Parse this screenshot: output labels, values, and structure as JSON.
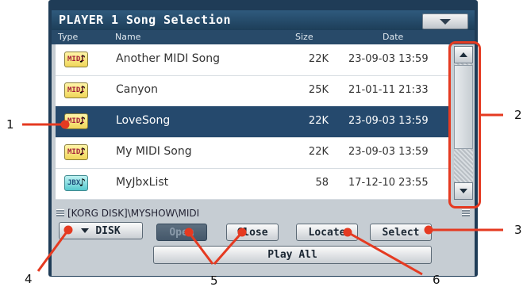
{
  "window": {
    "title": "PLAYER 1 Song Selection"
  },
  "columns": {
    "type": "Type",
    "name": "Name",
    "size": "Size",
    "date": "Date"
  },
  "rows": [
    {
      "icon": "MIDI",
      "name": "Another MIDI Song",
      "size": "22K",
      "date": "23-09-03 13:59",
      "selected": false
    },
    {
      "icon": "MIDI",
      "name": "Canyon",
      "size": "25K",
      "date": "21-01-11 21:33",
      "selected": false
    },
    {
      "icon": "MIDI",
      "name": "LoveSong",
      "size": "22K",
      "date": "23-09-03 13:59",
      "selected": true
    },
    {
      "icon": "MIDI",
      "name": "My MIDI Song",
      "size": "22K",
      "date": "23-09-03 13:59",
      "selected": false
    },
    {
      "icon": "JBX",
      "name": "MyJbxList",
      "size": "58",
      "date": "17-12-10 23:55",
      "selected": false
    }
  ],
  "path": "[KORG DISK]\\MYSHOW\\MIDI",
  "buttons": {
    "disk": "DISK",
    "open": "Open",
    "close": "Close",
    "locate": "Locate",
    "select": "Select",
    "play_all": "Play All"
  },
  "callouts": {
    "c1": "1",
    "c2": "2",
    "c3": "3",
    "c4": "4",
    "c5": "5",
    "c6": "6"
  },
  "colors": {
    "accent_red": "#e53a21",
    "title_blue": "#1d3e59",
    "selection": "#25496d"
  },
  "icons": {
    "menu": "chevron-down-icon",
    "note": "music-note-icon"
  }
}
